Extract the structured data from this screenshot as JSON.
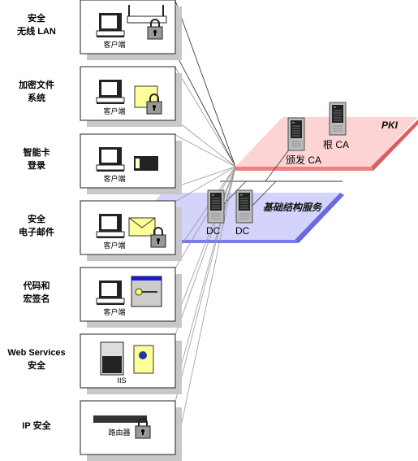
{
  "scenarios": [
    {
      "label": "安全\n无线 LAN",
      "caption": "客户端",
      "icon": "wireless-router-lock-icon"
    },
    {
      "label": "加密文件\n系统",
      "caption": "客户端",
      "icon": "encrypted-folder-icon"
    },
    {
      "label": "智能卡\n登录",
      "caption": "客户端",
      "icon": "smart-card-icon"
    },
    {
      "label": "安全\n电子邮件",
      "caption": "客户端",
      "icon": "secure-mail-icon"
    },
    {
      "label": "代码和\n宏签名",
      "caption": "客户端",
      "icon": "code-signing-key-icon"
    },
    {
      "label": "Web Services\n安全",
      "caption": "IIS",
      "icon": "web-certificate-icon"
    },
    {
      "label": "IP 安全",
      "caption": "路由器",
      "icon": "router-lock-icon"
    }
  ],
  "pki": {
    "title": "PKI",
    "issuing_ca": "颁发 CA",
    "root_ca": "根 CA",
    "color": "#fdd3d3",
    "edge_color": "#e07070"
  },
  "infrastructure": {
    "title": "基础结构服务",
    "dc1": "DC",
    "dc2": "DC",
    "color": "#d3d3fb",
    "edge_color": "#6a6ae0"
  }
}
